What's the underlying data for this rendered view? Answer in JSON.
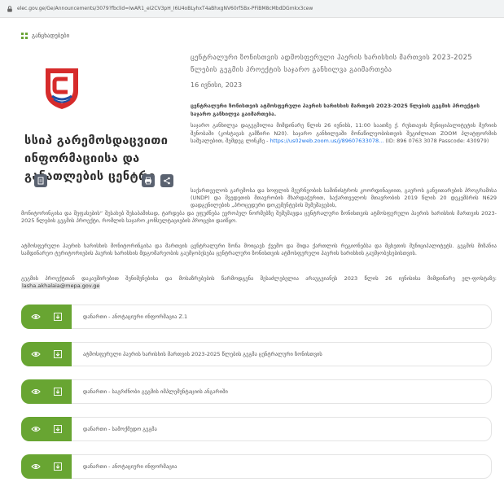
{
  "browser": {
    "url": "elec.gov.ge/Ge/Announcements/3079?fbclid=IwAR1_eI2CV3pH_I6U4oBLyhxT4aBhxgNV60rf5Bx-PFiBM8cMbdDGmkx3cew"
  },
  "header": {
    "announcements_label": "განცხადებები"
  },
  "org": {
    "name": "სსიპ გარემოსდაცვითი ინფორმაციისა და განათლების ცენტრი"
  },
  "article": {
    "title": "ცენტრალური ზონისთვის ადმოსფერული ჰაერის ხარისხის მართვის 2023-2025 წლების გეგმის პროექტის საჯარო განხილვა გაიმართება",
    "date": "16 ივნისი, 2023",
    "lead": "ცენტრალური ზონისთვის ატმოსფერული ჰაერის ხარისხის მართვის 2023-2025 წლების გეგმის პროექტის საჯარო განხილვა გაიმართება.",
    "para1_text": "საჯარო განხილვა დაგეგმილია მიმდინარე წლის 26 ივნისს, 11:00 საათზე ქ. რუსთავის მუნიციპალიტეტის მერიის შენობაში (კოსტავას გამზირი N20). საჯარო განხილვაში მონაწილეობისთვის შეგიძლიათ ZOOM პლატფორმის საშუალებით, შემდეგ ლინკზე - ",
    "para1_link": "https://us02web.zoom.us/j/89607633078...",
    "para1_tail": " (ID: 896 0763 3078 Passcode: 430979)",
    "para2_a": "საქართველოს გარემოსა და სოფლის მეურნეობის სამინისტროს კოორდინაციით, გაეროს განვითარების პროგრამისა (UNDP) და შვედეთის მთავრობის მხარდაჭერით, საქართველოს მთავრობის 2019 წლის 20 დეკემბრის N629 დადგენილების „პროცედური დოკუმენტების შემუშავების,",
    "para2_b": "მონიტორინგისა და შეფასების“ შესახებ შესაბამისად, ტარდება და ეფუძნება ევროპულ ნორმებზე შემუშავდა ცენტრალური ზონისთვის ატმოსფერული ჰაერის ხარისხის მართვის 2023-2025 წლების გეგმის პროექტი, რომლის საჯარო კონსულტაციების პროცესი დაიწყო.",
    "para3": "ატმოსფერული ჰაერის ხარისხის მონიტორინგისა და მართვის ცენტრალური ზონა მოიცავს ქვემო და შიდა ქართლის რეგიონებსა და მცხეთის მუნიციპალიტეტს. გეგმის მიზანია სამდინარეო ტერიტორიების ჰაერის ხარისხის მდგომარეობის გაუმჯობესება ცენტრალური ზონისთვის ატმოსფერული ჰაერის ხარისხის გაუმჯობესებისთვის.",
    "para4_text": "გეგმის პროექტთან დაკავშირებით შენიშვნებისა და მოსაზრებების წარმოდგენა შესაძლებელია არაუგვიანეს 2023 წლის 26 ივნისისა მიმდინარე ელ-ფოსტაზე: ",
    "para4_email": "lasha.akhalaia@mepa.gov.ge"
  },
  "files": [
    {
      "name": "დანართი - ანოტაციური ინფორმაცია Z.1"
    },
    {
      "name": "ატმოსფერული ჰაერის ხარისხის მართვის 2023-2025 წლების გეგმა ცენტრალური ზონისთვის"
    },
    {
      "name": "დანართი - საგრძნობი გეგმის იმპლემენტაციის ანგარიში"
    },
    {
      "name": "დანართი - სამოქმედო გეგმა"
    },
    {
      "name": "დანართი - ანოტაციური ინფორმაცია"
    }
  ],
  "colors": {
    "accent_green": "#68a532",
    "link_blue": "#1a73e8",
    "logo_red": "#d62b2b",
    "logo_blue": "#1f4fa3"
  }
}
